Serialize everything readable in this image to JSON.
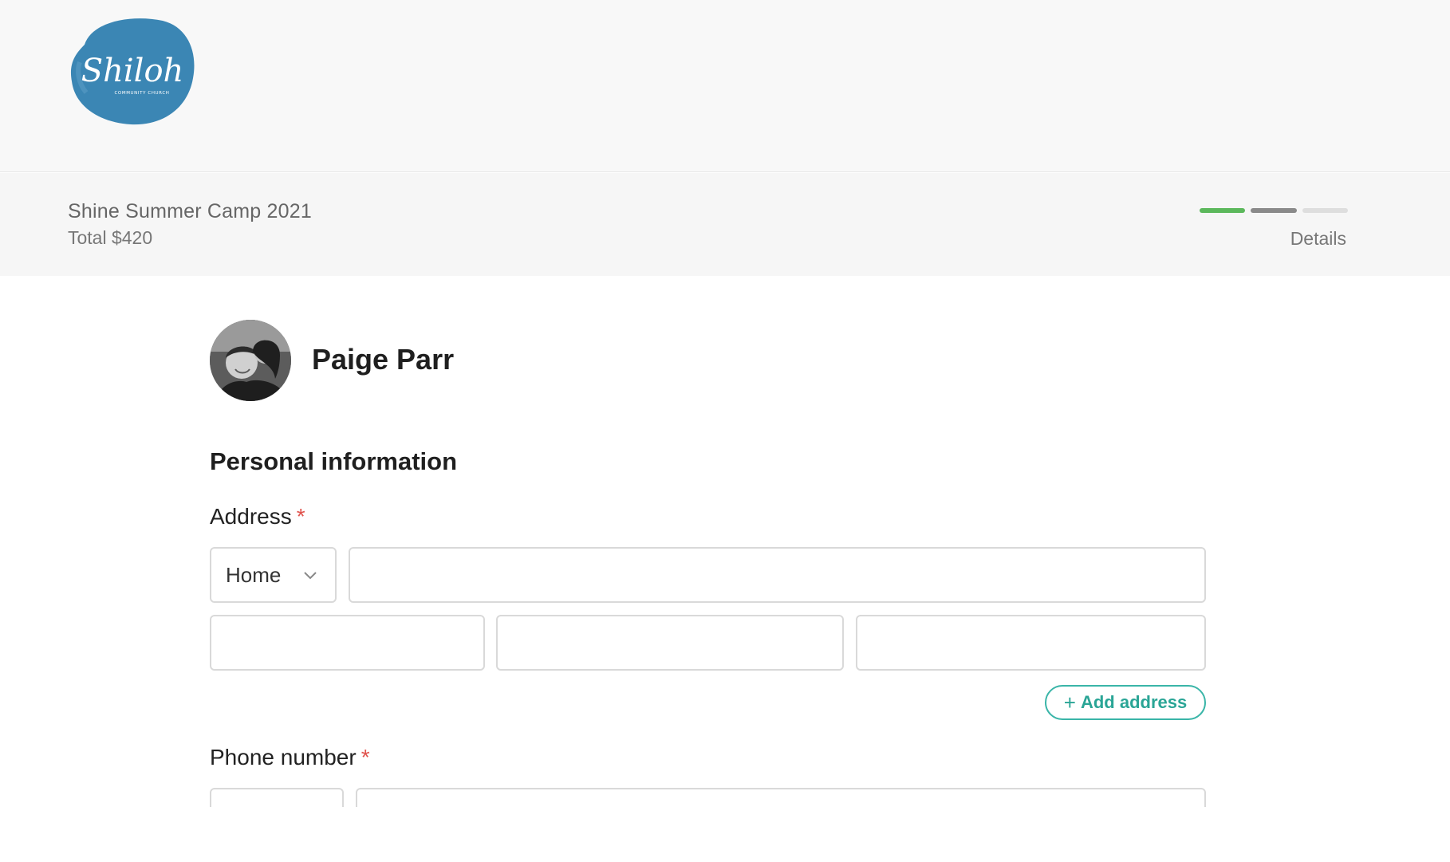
{
  "brand": {
    "logo_text": "Shiloh",
    "logo_subtext": "COMMUNITY CHURCH",
    "logo_color": "#3b86b4"
  },
  "event": {
    "title": "Shine Summer Camp 2021",
    "total": "Total $420"
  },
  "progress": {
    "steps_total": 3,
    "current_step": 2,
    "colors": [
      "#5cb85c",
      "#8a8a8a",
      "#dedede"
    ],
    "label": "Details"
  },
  "profile": {
    "name": "Paige Parr",
    "avatar_icon": "profile-photo"
  },
  "form": {
    "section_title": "Personal information",
    "address": {
      "label": "Address",
      "required_marker": "*",
      "type_selected": "Home",
      "street_value": "",
      "city_value": "",
      "state_value": "",
      "zip_value": "",
      "add_button_label": "Add address",
      "add_button_icon": "plus-icon"
    },
    "phone": {
      "label": "Phone number",
      "required_marker": "*",
      "country_value": "",
      "number_value": ""
    }
  },
  "colors": {
    "accent": "#2aa596",
    "required": "#e0534d"
  }
}
